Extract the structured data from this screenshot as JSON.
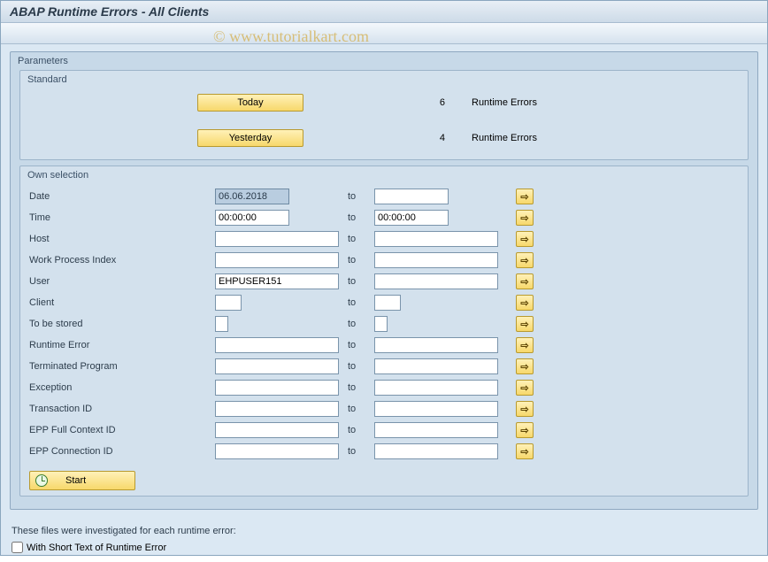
{
  "window": {
    "title": "ABAP Runtime Errors - All Clients"
  },
  "watermark": "© www.tutorialkart.com",
  "panel": {
    "title": "Parameters"
  },
  "standard": {
    "title": "Standard",
    "today_label": "Today",
    "today_count": "6",
    "today_text": "Runtime Errors",
    "yesterday_label": "Yesterday",
    "yesterday_count": "4",
    "yesterday_text": "Runtime Errors"
  },
  "own": {
    "title": "Own selection",
    "to_label": "to",
    "rows": {
      "date": {
        "label": "Date",
        "from": "06.06.2018",
        "to": ""
      },
      "time": {
        "label": "Time",
        "from": "00:00:00",
        "to": "00:00:00"
      },
      "host": {
        "label": "Host",
        "from": "",
        "to": ""
      },
      "wpi": {
        "label": "Work Process Index",
        "from": "",
        "to": ""
      },
      "user": {
        "label": "User",
        "from": "EHPUSER151",
        "to": ""
      },
      "client": {
        "label": "Client",
        "from": "",
        "to": ""
      },
      "stored": {
        "label": "To be stored",
        "from": "",
        "to": ""
      },
      "rerr": {
        "label": "Runtime Error",
        "from": "",
        "to": ""
      },
      "tprog": {
        "label": "Terminated Program",
        "from": "",
        "to": ""
      },
      "exc": {
        "label": "Exception",
        "from": "",
        "to": ""
      },
      "txid": {
        "label": "Transaction ID",
        "from": "",
        "to": ""
      },
      "eppf": {
        "label": "EPP Full Context ID",
        "from": "",
        "to": ""
      },
      "eppc": {
        "label": "EPP Connection ID",
        "from": "",
        "to": ""
      }
    }
  },
  "start": {
    "label": "Start"
  },
  "footer": {
    "text": "These files were investigated for each runtime error:",
    "checkbox_label": "With Short Text of Runtime Error",
    "checked": false
  }
}
